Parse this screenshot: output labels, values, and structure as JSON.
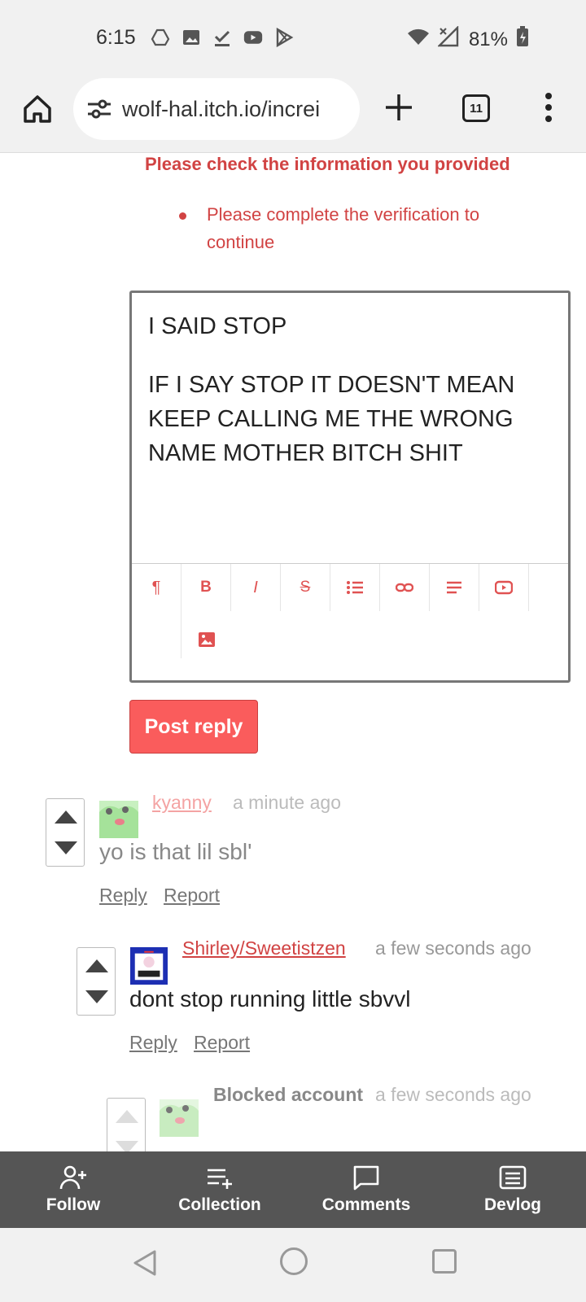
{
  "status_bar": {
    "time": "6:15",
    "battery": "81%",
    "left_icons": [
      "drive-icon",
      "gallery-icon",
      "check-download-icon",
      "youtube-icon",
      "play-store-icon"
    ],
    "right_icons": [
      "wifi-icon",
      "no-signal-icon",
      "battery-charging-icon"
    ]
  },
  "browser": {
    "url": "wolf-hal.itch.io/increi",
    "tab_count": "11"
  },
  "errors": {
    "title": "Please check the information you provided",
    "items": [
      "Please complete the verification to continue"
    ]
  },
  "editor": {
    "line1": "I SAID STOP",
    "line2": "IF I SAY STOP IT DOESN'T MEAN KEEP CALLING ME THE WRONG NAME MOTHER BITCH SHIT",
    "toolbar": {
      "paragraph": "¶",
      "bold": "B",
      "italic": "I",
      "strike": "S"
    }
  },
  "post_button": "Post reply",
  "comments": [
    {
      "username": "kyanny",
      "time": "a minute ago",
      "body": "yo is that lil sbl'",
      "reply": "Reply",
      "report": "Report"
    },
    {
      "username": "Shirley/Sweetistzen",
      "time": "a few seconds ago",
      "body": "dont stop running little sbvvl",
      "reply": "Reply",
      "report": "Report"
    },
    {
      "username": "Blocked account",
      "time": "a few seconds ago"
    }
  ],
  "tabbar": {
    "follow": "Follow",
    "collection": "Collection",
    "comments": "Comments",
    "devlog": "Devlog"
  },
  "colors": {
    "accent": "#fa5c5c",
    "error": "#d14343",
    "tabbar_bg": "#555555"
  }
}
